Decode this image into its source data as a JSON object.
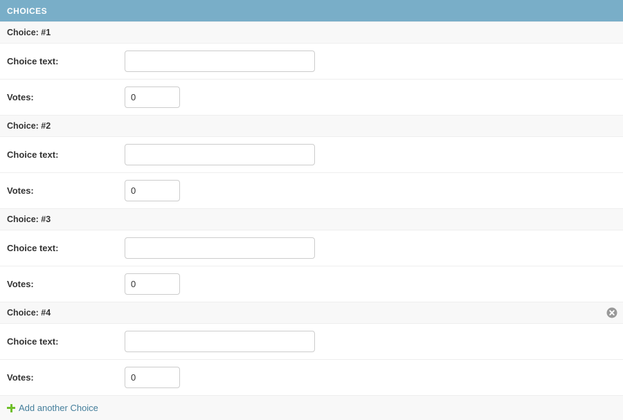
{
  "module": {
    "header_title": "CHOICES"
  },
  "inlines": [
    {
      "heading": "Choice: #1",
      "deletable": false,
      "fields": {
        "choice_text_label": "Choice text:",
        "choice_text_value": "",
        "votes_label": "Votes:",
        "votes_value": "0"
      }
    },
    {
      "heading": "Choice: #2",
      "deletable": false,
      "fields": {
        "choice_text_label": "Choice text:",
        "choice_text_value": "",
        "votes_label": "Votes:",
        "votes_value": "0"
      }
    },
    {
      "heading": "Choice: #3",
      "deletable": false,
      "fields": {
        "choice_text_label": "Choice text:",
        "choice_text_value": "",
        "votes_label": "Votes:",
        "votes_value": "0"
      }
    },
    {
      "heading": "Choice: #4",
      "deletable": true,
      "delete_icon_name": "remove-circle-icon",
      "fields": {
        "choice_text_label": "Choice text:",
        "choice_text_value": "",
        "votes_label": "Votes:",
        "votes_value": "0"
      }
    }
  ],
  "add_row": {
    "icon_name": "plus-icon",
    "label": "Add another Choice"
  },
  "colors": {
    "header_bg": "#79aec8",
    "header_text": "#ffffff",
    "strip_bg": "#f8f8f8",
    "border": "#eeeeee",
    "link": "#447e9b",
    "add_icon": "#70bf2b",
    "delete_icon": "#999999",
    "input_border": "#cccccc",
    "text": "#333333"
  }
}
